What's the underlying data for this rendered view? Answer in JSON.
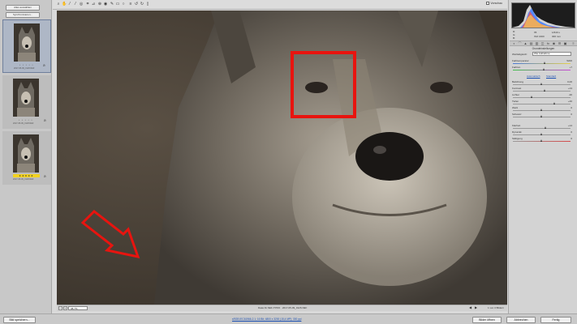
{
  "filmstrip": {
    "select_all_label": "Alles auswählen",
    "synchronize_label": "Synchronisieren...",
    "thumbnails": [
      {
        "stars": "• • • • •",
        "filename": "2017-05-09_0126.NEF",
        "rating_yellow": false,
        "selected": true
      },
      {
        "stars": "• • • • •",
        "filename": "2017-05-09_0126.NEF",
        "rating_yellow": false,
        "selected": false
      },
      {
        "stars": "★★★★★",
        "filename": "2017-05-09_0126.NEF",
        "rating_yellow": true,
        "selected": false
      }
    ]
  },
  "toolbar": {
    "preview_label": "Vorschau",
    "tools": [
      "zoom-icon",
      "hand-icon",
      "white-balance-icon",
      "color-sampler-icon",
      "target-adjust-icon",
      "crop-icon",
      "straighten-icon",
      "spot-removal-icon",
      "red-eye-icon",
      "adjustment-brush-icon",
      "graduated-filter-icon",
      "radial-filter-icon",
      "preferences-icon",
      "rotate-left-icon",
      "rotate-right-icon",
      "trash-icon"
    ]
  },
  "canvas_status": {
    "zoom_value": "38,7%",
    "file_label": "Datei-Nr.NEF-TPRO · 2017-05-09_0126.NEF",
    "image_count": "1 von 3 Bildern",
    "prev_arrow": "◀",
    "next_arrow": "▶"
  },
  "right_panel": {
    "cam_info": {
      "r": "R:",
      "g": "G:",
      "b": "B:",
      "aperture": "f/5",
      "shutter": "1/640 s",
      "iso": "ISO 1600",
      "focal": "300 mm"
    },
    "panel_title": "Grundeinstellungen",
    "white_balance_label": "Weißabgleich:",
    "white_balance_value": "Wie Aufnahme",
    "rows": [
      {
        "label": "Farbtemperatur",
        "value": "5200"
      },
      {
        "label": "Farbton",
        "value": "+7"
      },
      {
        "label": "Belichtung",
        "value": "0,00"
      },
      {
        "label": "Kontrast",
        "value": "+13"
      },
      {
        "label": "Lichter",
        "value": "-36"
      },
      {
        "label": "Tiefen",
        "value": "+46"
      },
      {
        "label": "Weiß",
        "value": "0"
      },
      {
        "label": "Schwarz",
        "value": "0"
      },
      {
        "label": "Klarheit",
        "value": "+14"
      },
      {
        "label": "Dynamik",
        "value": "0"
      },
      {
        "label": "Sättigung",
        "value": "0"
      }
    ],
    "auto_link": "Automatisch",
    "default_link": "Standard"
  },
  "bottom_bar": {
    "save_label": "Bild speichern...",
    "workflow_text": "sRGB IEC61966-2.1; 16 Bit; 4800 x 3200 (15,4 MP); 300 ppi",
    "open_label": "Bilder öffnen",
    "cancel_label": "Abbrechen",
    "done_label": "Fertig"
  }
}
